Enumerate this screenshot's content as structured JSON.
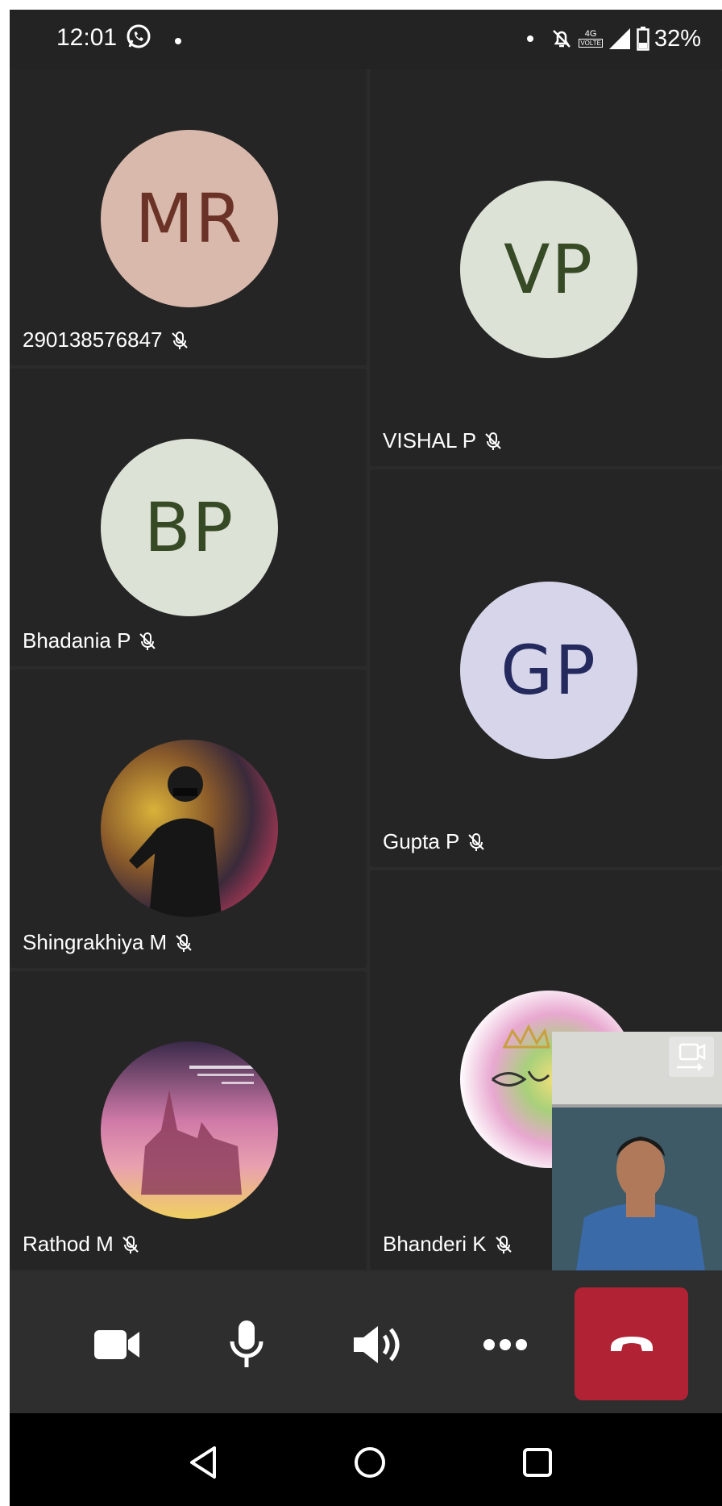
{
  "status_bar": {
    "time": "12:01",
    "network": "4G",
    "network_sub": "VOLTE",
    "battery": "32%",
    "icons": [
      "whatsapp-icon",
      "notifications-muted-icon",
      "signal-icon",
      "battery-icon"
    ]
  },
  "participants": [
    {
      "initials": "MR",
      "name": "290138576847",
      "muted": true,
      "avatar_bg": "#d9b9ac",
      "avatar_fg": "#6b3328"
    },
    {
      "initials": "VP",
      "name": "VISHAL P",
      "muted": true,
      "avatar_bg": "#dde2d6",
      "avatar_fg": "#374a26"
    },
    {
      "initials": "BP",
      "name": "Bhadania P",
      "muted": true,
      "avatar_bg": "#dde2d6",
      "avatar_fg": "#374a26"
    },
    {
      "initials": "GP",
      "name": "Gupta P",
      "muted": true,
      "avatar_bg": "#d6d5ea",
      "avatar_fg": "#252a5e"
    },
    {
      "initials": "",
      "name": "Shingrakhiya M",
      "muted": true,
      "avatar": "photo"
    },
    {
      "initials": "",
      "name": "Rathod M",
      "muted": true,
      "avatar": "photo"
    },
    {
      "initials": "",
      "name": "Bhanderi K",
      "muted": true,
      "avatar": "photo"
    }
  ],
  "controls": {
    "video": "camera-icon",
    "mic": "microphone-icon",
    "speaker": "speaker-icon",
    "more": "more-options-icon",
    "hangup": "hang-up-icon",
    "hangup_color": "#b22235"
  },
  "nav": {
    "back": "back-icon",
    "home": "home-icon",
    "recents": "recents-icon"
  }
}
